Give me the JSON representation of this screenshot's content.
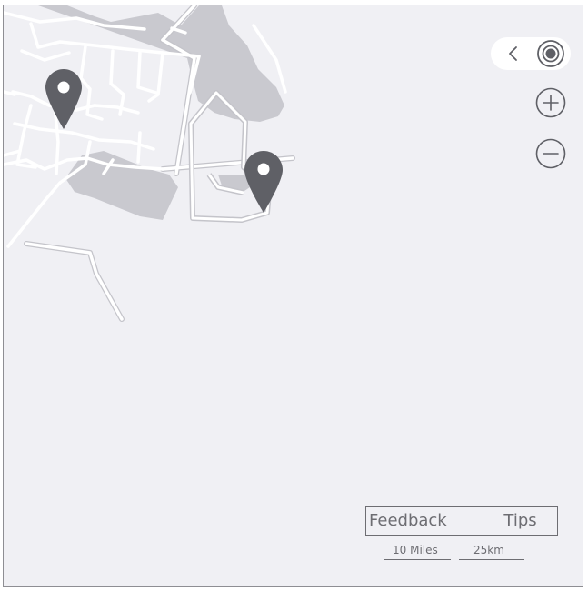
{
  "map": {
    "land_color": "#f0f0f4",
    "water_color": "#c9c9cf",
    "road_color": "#ffffff",
    "pin_color": "#5f6066"
  },
  "pins": [
    {
      "icon": "map-pin-icon"
    },
    {
      "icon": "map-pin-icon"
    }
  ],
  "controls": {
    "collapse_icon": "chevron-left-icon",
    "locate_icon": "target-icon",
    "zoom_in_icon": "plus-circle-icon",
    "zoom_out_icon": "minus-circle-icon"
  },
  "footer": {
    "feedback_label": "Feedback",
    "tips_label": "Tips",
    "scale_miles": "10 Miles",
    "scale_km": "25km"
  }
}
